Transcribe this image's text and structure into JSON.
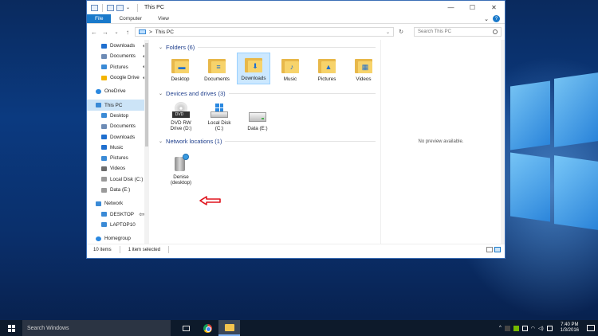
{
  "window": {
    "title": "This PC",
    "controls": {
      "minimize": "—",
      "maximize": "☐",
      "close": "✕"
    }
  },
  "ribbon": {
    "tabs": [
      "File",
      "Computer",
      "View"
    ],
    "expand": "⌄",
    "help": "?"
  },
  "address": {
    "back": "←",
    "forward": "→",
    "recent": "⌄",
    "up": "↑",
    "separator": ">",
    "path": "This PC",
    "dropdown": "⌄",
    "refresh": "↻",
    "search_placeholder": "Search This PC"
  },
  "nav_pane": {
    "quick_access": [
      {
        "label": "Downloads",
        "icon": "download-icon",
        "color": "#1f6fcf",
        "pinned": "📌"
      },
      {
        "label": "Documents",
        "icon": "documents-icon",
        "color": "#6d8bb5",
        "pinned": "📌"
      },
      {
        "label": "Pictures",
        "icon": "pictures-icon",
        "color": "#3a8ad6",
        "pinned": "📌"
      },
      {
        "label": "Google Drive",
        "icon": "google-drive-icon",
        "color": "#f4b400",
        "pinned": "📌"
      }
    ],
    "onedrive": "OneDrive",
    "this_pc": "This PC",
    "this_pc_items": [
      {
        "label": "Desktop",
        "icon": "desktop-icon",
        "color": "#3a8ad6"
      },
      {
        "label": "Documents",
        "icon": "documents-icon",
        "color": "#6d8bb5"
      },
      {
        "label": "Downloads",
        "icon": "download-icon",
        "color": "#1f6fcf"
      },
      {
        "label": "Music",
        "icon": "music-icon",
        "color": "#1f6fcf"
      },
      {
        "label": "Pictures",
        "icon": "pictures-icon",
        "color": "#3a8ad6"
      },
      {
        "label": "Videos",
        "icon": "videos-icon",
        "color": "#6b6b6b"
      },
      {
        "label": "Local Disk (C:)",
        "icon": "local-disk-icon",
        "color": "#9a9a9a"
      },
      {
        "label": "Data (E:)",
        "icon": "drive-icon",
        "color": "#9a9a9a"
      }
    ],
    "network": "Network",
    "network_items": [
      {
        "label": "DESKTOP",
        "icon": "computer-icon",
        "color": "#3a8ad6"
      },
      {
        "label": "LAPTOP10",
        "icon": "computer-icon",
        "color": "#3a8ad6"
      }
    ],
    "homegroup": "Homegroup"
  },
  "content": {
    "folders_header": "Folders (6)",
    "folders": [
      {
        "label": "Desktop",
        "glyph": "▬"
      },
      {
        "label": "Documents",
        "glyph": "≡"
      },
      {
        "label": "Downloads",
        "glyph": "⬇"
      },
      {
        "label": "Music",
        "glyph": "♪"
      },
      {
        "label": "Pictures",
        "glyph": "▲"
      },
      {
        "label": "Videos",
        "glyph": "▦"
      }
    ],
    "devices_header": "Devices and drives (3)",
    "drives": [
      {
        "line1": "DVD RW",
        "line2": "Drive (D:)",
        "tray": "DVD"
      },
      {
        "line1": "Local Disk",
        "line2": "(C:)"
      },
      {
        "line1": "Data (E:)",
        "line2": ""
      }
    ],
    "network_header": "Network locations (1)",
    "network_location": {
      "line1": "Denise",
      "line2": "(desktop)"
    }
  },
  "preview": {
    "text": "No preview available."
  },
  "status": {
    "items": "10 items",
    "selected": "1 item selected"
  },
  "taskbar": {
    "search_placeholder": "Search Windows",
    "time": "7:40 PM",
    "date": "1/3/2016"
  }
}
